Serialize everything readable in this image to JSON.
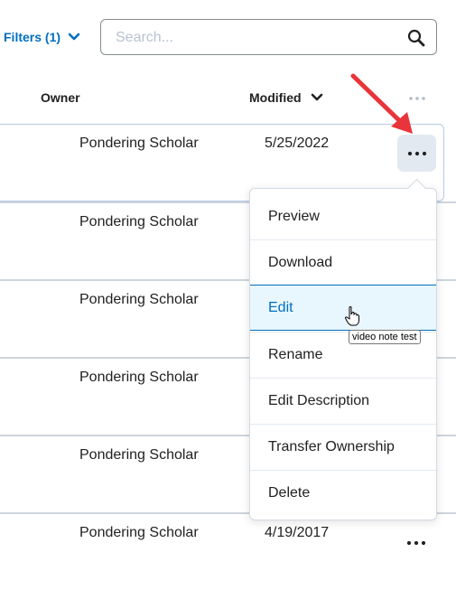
{
  "toolbar": {
    "filters_label": "Filters (1)",
    "search_placeholder": "Search...",
    "search_value": ""
  },
  "columns": {
    "owner": "Owner",
    "modified": "Modified",
    "modified_sort": "descending"
  },
  "rows": [
    {
      "owner": "Pondering Scholar",
      "modified": "5/25/2022"
    },
    {
      "owner": "Pondering Scholar",
      "modified": ""
    },
    {
      "owner": "Pondering Scholar",
      "modified": ""
    },
    {
      "owner": "Pondering Scholar",
      "modified": ""
    },
    {
      "owner": "Pondering Scholar",
      "modified": ""
    },
    {
      "owner": "Pondering Scholar",
      "modified": "4/19/2017"
    }
  ],
  "context_menu": {
    "items": [
      "Preview",
      "Download",
      "Edit",
      "Rename",
      "Edit Description",
      "Transfer Ownership",
      "Delete"
    ],
    "hovered": "Edit"
  },
  "tooltip": "video note test",
  "colors": {
    "accent": "#006fbf",
    "hover_bg": "#e8f6fd",
    "annotation_arrow": "#e8343a"
  }
}
